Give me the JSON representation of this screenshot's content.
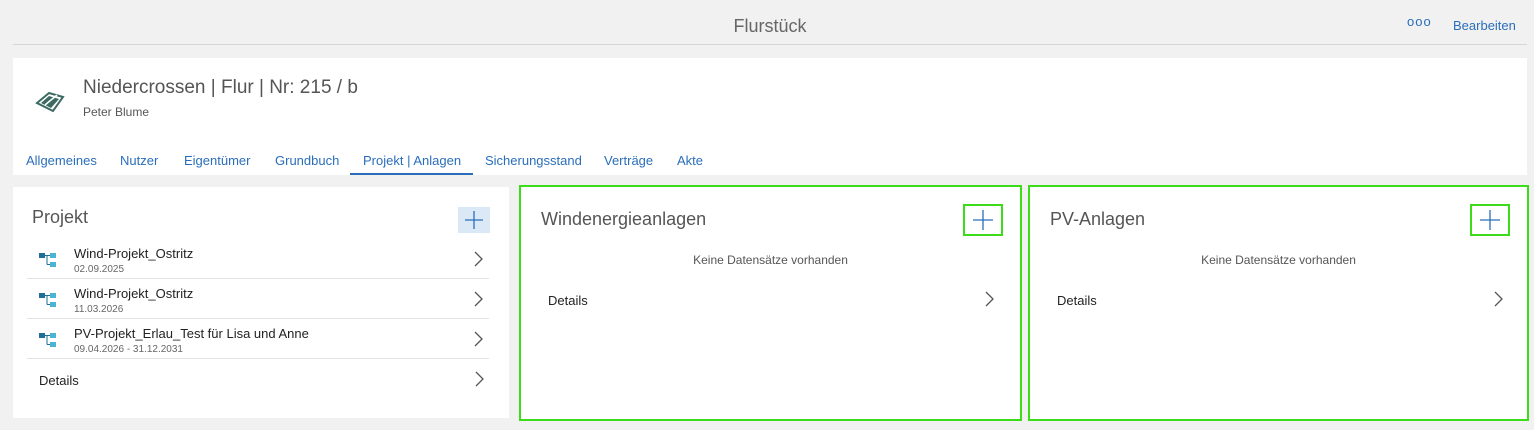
{
  "topbar": {
    "title": "Flurstück",
    "more_label": "ooo",
    "edit_label": "Bearbeiten"
  },
  "header": {
    "title": "Niedercrossen | Flur | Nr: 215 / b",
    "subtitle": "Peter Blume",
    "icon": "parcel-map-icon"
  },
  "tabs": [
    {
      "label": "Allgemeines"
    },
    {
      "label": "Nutzer"
    },
    {
      "label": "Eigentümer"
    },
    {
      "label": "Grundbuch"
    },
    {
      "label": "Projekt | Anlagen",
      "active": true
    },
    {
      "label": "Sicherungsstand"
    },
    {
      "label": "Verträge"
    },
    {
      "label": "Akte"
    }
  ],
  "project_card": {
    "title": "Projekt",
    "items": [
      {
        "name": "Wind-Projekt_Ostritz",
        "date": "02.09.2025"
      },
      {
        "name": "Wind-Projekt_Ostritz",
        "date": "11.03.2026"
      },
      {
        "name": "PV-Projekt_Erlau_Test für Lisa und Anne",
        "date": "09.04.2026 - 31.12.2031"
      }
    ],
    "details_label": "Details"
  },
  "wind_card": {
    "title": "Windenergieanlagen",
    "empty_text": "Keine Datensätze vorhanden",
    "details_label": "Details"
  },
  "pv_card": {
    "title": "PV-Anlagen",
    "empty_text": "Keine Datensätze vorhanden",
    "details_label": "Details"
  },
  "colors": {
    "accent": "#2a6ebb",
    "highlight": "#3ddc1a",
    "icon_teal": "#4bb3d6"
  }
}
